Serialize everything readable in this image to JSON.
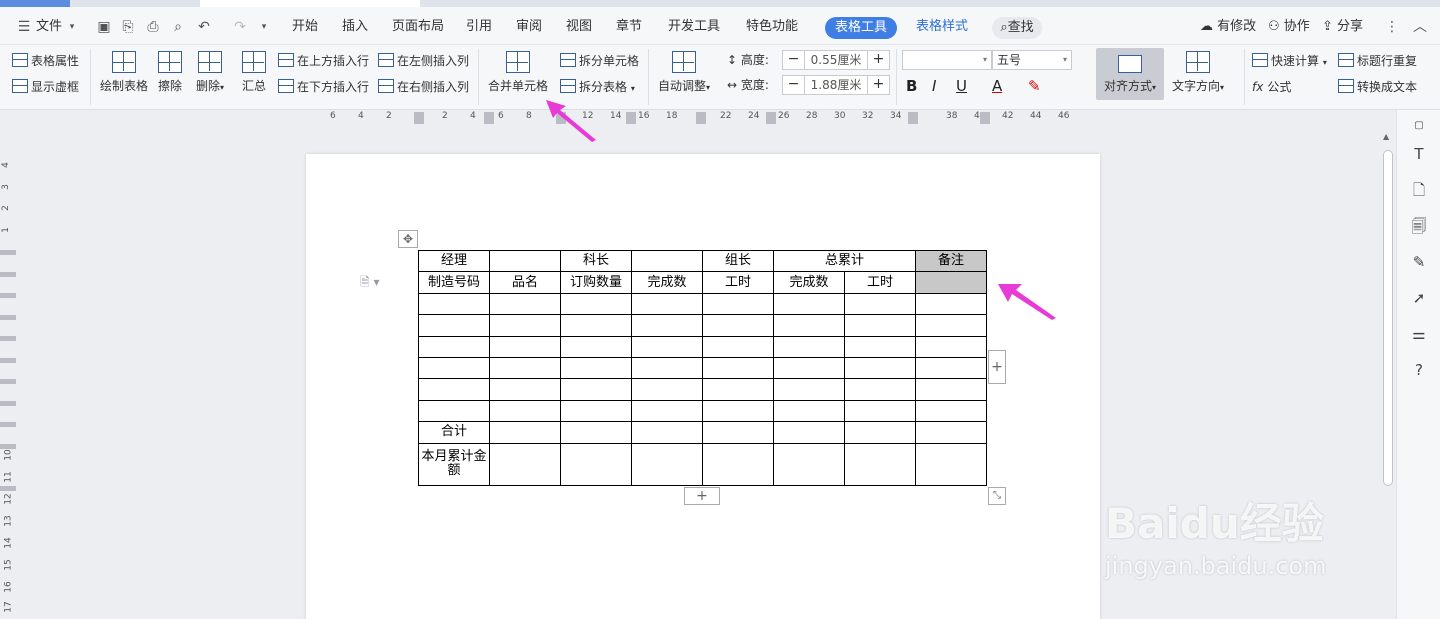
{
  "menubar": {
    "file_label": "文件",
    "tabs": [
      "开始",
      "插入",
      "页面布局",
      "引用",
      "审阅",
      "视图",
      "章节",
      "开发工具",
      "特色功能"
    ],
    "table_tool": "表格工具",
    "table_style": "表格样式",
    "search": "查找",
    "modified": "有修改",
    "collab": "协作",
    "share": "分享"
  },
  "ribbon": {
    "table_props": "表格属性",
    "show_grid": "显示虚框",
    "draw_table": "绘制表格",
    "erase": "擦除",
    "delete": "删除",
    "summary": "汇总",
    "insert_above": "在上方插入行",
    "insert_below": "在下方插入行",
    "insert_left": "在左侧插入列",
    "insert_right": "在右侧插入列",
    "merge_cells": "合并单元格",
    "split_cells": "拆分单元格",
    "split_table": "拆分表格",
    "auto_adjust": "自动调整",
    "height_label": "高度:",
    "height_value": "0.55厘米",
    "width_label": "宽度:",
    "width_value": "1.88厘米",
    "font_size": "五号",
    "align": "对齐方式",
    "text_dir": "文字方向",
    "quick_calc": "快速计算",
    "formula": "公式",
    "repeat_header": "标题行重复",
    "to_text": "转换成文本"
  },
  "ruler": {
    "h_ticks": [
      "6",
      "4",
      "2",
      "2",
      "4",
      "6",
      "8",
      "12",
      "14",
      "16",
      "18",
      "22",
      "24",
      "26",
      "28",
      "30",
      "32",
      "34",
      "38",
      "4",
      "42",
      "44",
      "46"
    ],
    "v_ticks": [
      "4",
      "3",
      "2",
      "1",
      "10",
      "11",
      "12",
      "13",
      "14",
      "15",
      "16",
      "17"
    ]
  },
  "table": {
    "rows": [
      [
        "经理",
        "",
        "科长",
        "",
        "组长",
        "总累计",
        "",
        "备注"
      ],
      [
        "制造号码",
        "品名",
        "订购数量",
        "完成数",
        "工时",
        "完成数",
        "工时",
        ""
      ],
      [
        "",
        "",
        "",
        "",
        "",
        "",
        "",
        ""
      ],
      [
        "",
        "",
        "",
        "",
        "",
        "",
        "",
        ""
      ],
      [
        "",
        "",
        "",
        "",
        "",
        "",
        "",
        ""
      ],
      [
        "",
        "",
        "",
        "",
        "",
        "",
        "",
        ""
      ],
      [
        "",
        "",
        "",
        "",
        "",
        "",
        "",
        ""
      ],
      [
        "",
        "",
        "",
        "",
        "",
        "",
        "",
        ""
      ],
      [
        "合计",
        "",
        "",
        "",
        "",
        "",
        "",
        ""
      ],
      [
        "本月累计金额",
        "",
        "",
        "",
        "",
        "",
        "",
        ""
      ]
    ]
  },
  "watermark": {
    "logo": "Baidu经验",
    "sub": "jingyan.baidu.com"
  },
  "colors": {
    "accent": "#3f7fe4",
    "annotation": "#e83ad6"
  }
}
